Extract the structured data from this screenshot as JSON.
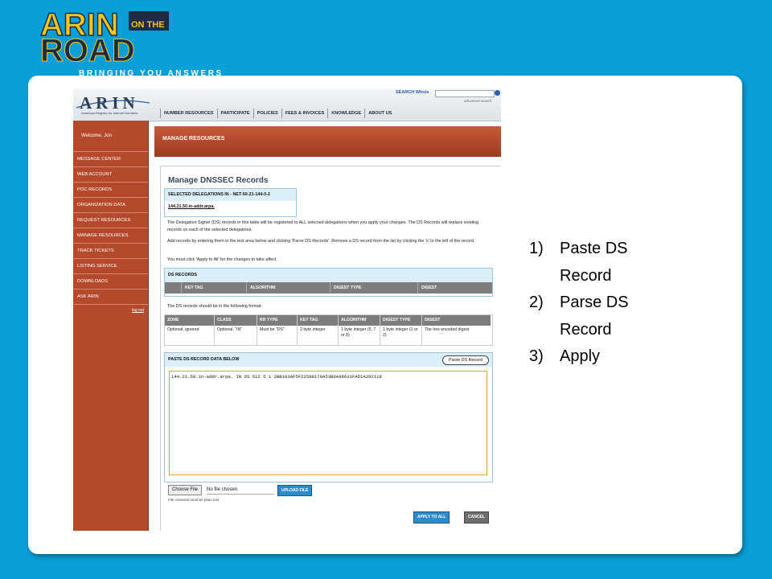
{
  "logo": {
    "word_top": "ARIN",
    "on_the": "ON THE",
    "word_bottom": "ROAD",
    "tagline": "BRINGING YOU ANSWERS"
  },
  "screenshot": {
    "brand": "ARIN",
    "brand_sub": "American Registry for Internet Numbers",
    "search_label": "SEARCH Whois",
    "advanced_search": "advanced search",
    "topnav": [
      "NUMBER RESOURCES",
      "PARTICIPATE",
      "POLICIES",
      "FEES & INVOICES",
      "KNOWLEDGE",
      "ABOUT US"
    ],
    "sidebar": {
      "welcome": "Welcome, Jon",
      "items": [
        "MESSAGE CENTER",
        "WEB ACCOUNT",
        "POC RECORDS",
        "ORGANIZATION DATA",
        "REQUEST RESOURCES",
        "MANAGE RESOURCES",
        "TRACK TICKETS",
        "LISTING SERVICE",
        "DOWNLOADS",
        "ASK ARIN"
      ],
      "logout": "log out"
    },
    "main_title": "MANAGE RESOURCES",
    "page_heading": "Manage DNSSEC Records",
    "selected": {
      "header": "SELECTED DELEGATIONS IN - NET-50-21-144-0-2",
      "delegation": "144.21.50.in-addr.arpa."
    },
    "para1": "The Delegation Signer (DS) records in this table will be registered to ALL selected delegations when you apply your changes. The DS Records will replace existing records on each of the selected delegations.",
    "para2": "Add records by entering them in the text area below and clicking 'Parse DS Records'. Remove a DS record from the list by clicking the 'x' to the left of the record.",
    "para3": "You must click 'Apply to All' for the changes to take affect.",
    "ds_records": {
      "header": "DS RECORDS",
      "columns": [
        "KEY TAG",
        "ALGORITHM",
        "DIGEST TYPE",
        "DIGEST"
      ]
    },
    "format_note": "The DS records should be in the following format:",
    "format_table": {
      "headers": [
        "ZONE",
        "CLASS",
        "RR TYPE",
        "KEY TAG",
        "ALGORITHM",
        "DIGEST TYPE",
        "DIGEST"
      ],
      "values": [
        "Optional, ignored",
        "Optional, \"IN\"",
        "Must be \"DS\"",
        "2 byte integer",
        "1 byte integer (5, 7 or 8)",
        "1 byte integer (1 or 2)",
        "The hex encoded digest"
      ]
    },
    "paste": {
      "header": "PASTE DS RECORD DATA BELOW",
      "parse_button": "Parse DS Record",
      "textarea_value": "144.21.50.in-addr.arpa. IN DS 512 5 1 2BB183AF5F22588179A53B0A98631FAD1A292118"
    },
    "choose_file": "Choose File",
    "no_file": "No file chosen",
    "upload": "UPLOAD FILE",
    "plain_text_note": "File contents must be plain text",
    "apply_all": "APPLY TO ALL",
    "cancel": "CANCEL"
  },
  "steps": [
    {
      "num": "1)",
      "text": "Paste DS Record"
    },
    {
      "num": "2)",
      "text": "Parse DS Record"
    },
    {
      "num": "3)",
      "text": "Apply"
    }
  ],
  "colors": {
    "background": "#0a9fd8",
    "logo_yellow": "#f5c518",
    "logo_navy": "#1f2a44",
    "sidebar": "#b5492b",
    "button_blue": "#2e8bc9"
  }
}
